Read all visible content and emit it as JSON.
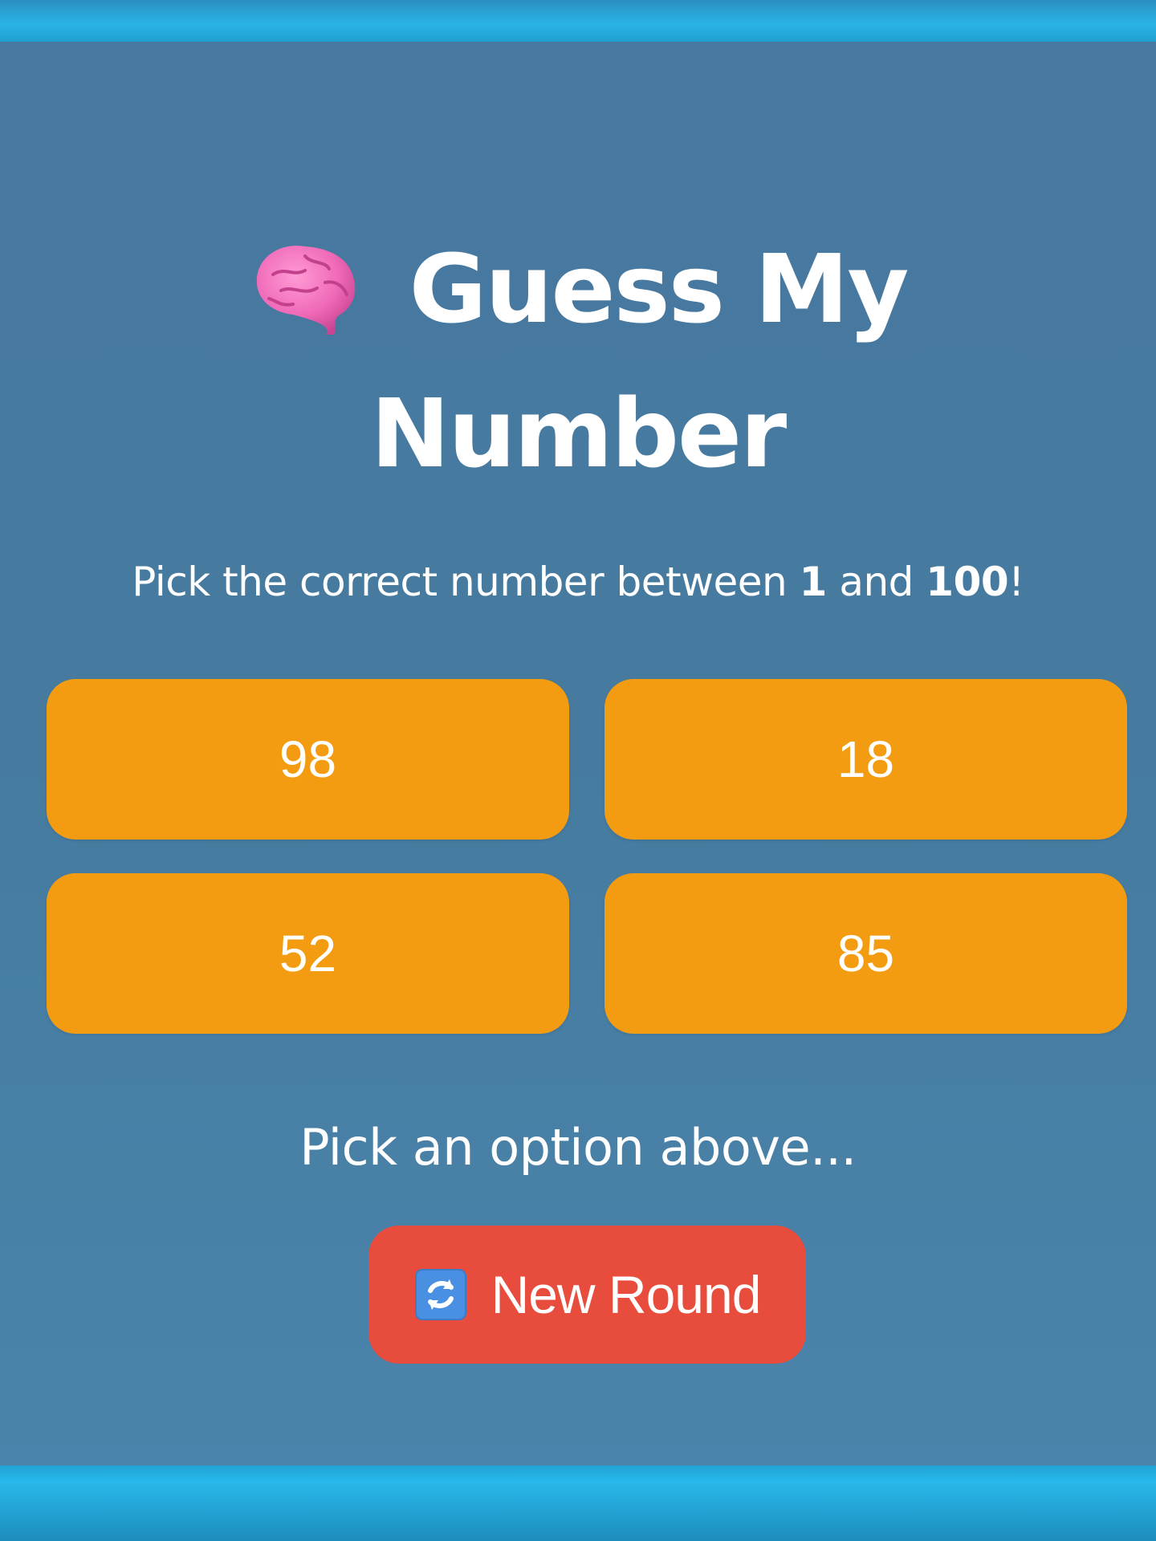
{
  "game": {
    "title_line1": "Guess My",
    "title_line2": "Number",
    "title_icon": "brain-icon",
    "subtitle_prefix": "Pick the correct number between ",
    "subtitle_min": "1",
    "subtitle_mid": " and ",
    "subtitle_max": "100",
    "subtitle_suffix": "!",
    "options": [
      "98",
      "18",
      "52",
      "85"
    ],
    "status": "Pick an option above...",
    "new_round_label": "New Round",
    "new_round_icon": "refresh-icon"
  },
  "colors": {
    "background": "#467b9f",
    "frame_accent": "#29b3e6",
    "option_button": "#f39c12",
    "new_round_button": "#e74c3c",
    "text": "#ffffff"
  }
}
